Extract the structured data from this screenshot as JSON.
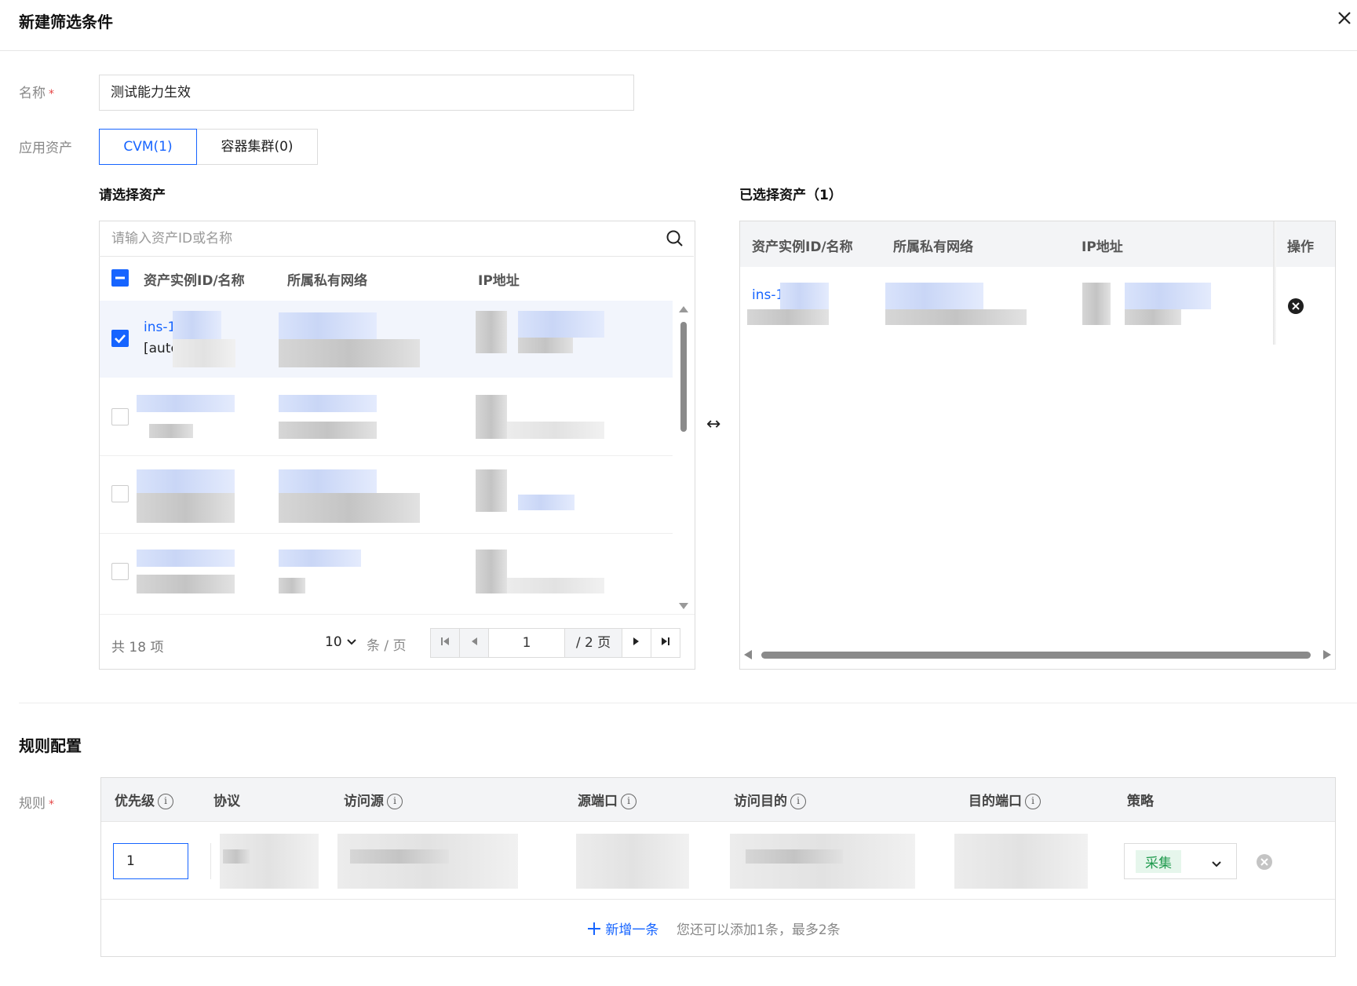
{
  "dialog": {
    "title": "新建筛选条件"
  },
  "form": {
    "name_label": "名称",
    "required_mark": "*",
    "name_value": "测试能力生效",
    "asset_label": "应用资产",
    "asset_tabs": [
      "CVM(1)",
      "容器集群(0)"
    ]
  },
  "left_panel": {
    "title": "请选择资产",
    "search_placeholder": "请输入资产ID或名称",
    "columns": [
      "资产实例ID/名称",
      "所属私有网络",
      "IP地址"
    ],
    "rows": [
      {
        "id_prefix": "ins-1",
        "name_prefix": "[autc",
        "checked": true
      }
    ],
    "total": "共 18 项",
    "page_size": "10",
    "page_size_unit": "条 / 页",
    "current_page": "1",
    "page_total": "/ 2 页"
  },
  "right_panel": {
    "title": "已选择资产（1）",
    "columns": [
      "资产实例ID/名称",
      "所属私有网络",
      "IP地址",
      "操作"
    ],
    "rows": [
      {
        "id_prefix": "ins-1"
      }
    ]
  },
  "transfer_icon": "↔",
  "rules": {
    "section_title": "规则配置",
    "label": "规则",
    "columns": [
      "优先级",
      "协议",
      "访问源",
      "源端口",
      "访问目的",
      "目的端口",
      "策略"
    ],
    "info_mark": "i",
    "row": {
      "priority": "1",
      "strategy": "采集"
    },
    "add_label": "新增一条",
    "add_hint": "您还可以添加1条，最多2条"
  },
  "colors": {
    "accent": "#1664ff",
    "required": "#e54545",
    "tag_green": "#1f9a4d"
  }
}
